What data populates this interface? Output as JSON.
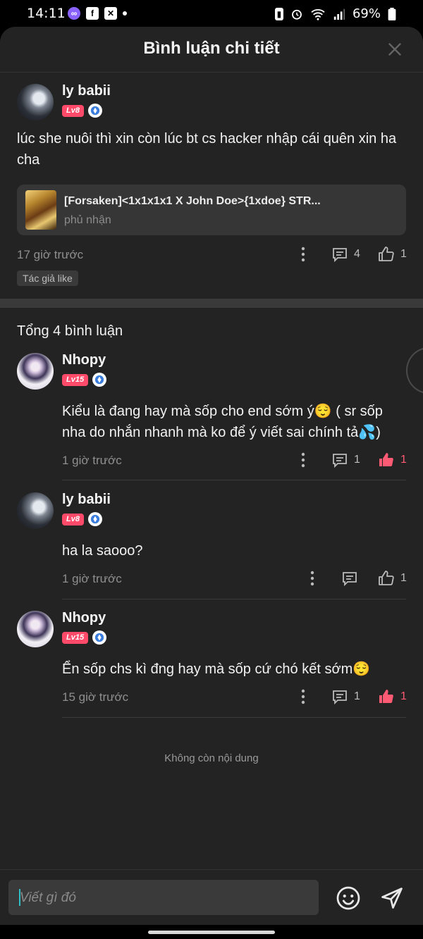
{
  "status_bar": {
    "time": "14:11",
    "battery": "69%",
    "left_icons": [
      "messenger-icon",
      "facebook-icon",
      "capcut-icon",
      "dot-icon"
    ],
    "right_icons": [
      "battery-saver-icon",
      "alarm-icon",
      "wifi-icon",
      "signal-icon",
      "battery-icon"
    ]
  },
  "header": {
    "title": "Bình luận chi tiết"
  },
  "main_comment": {
    "username": "ly babii",
    "level": "Lv8",
    "text": "lúc she nuôi thì xin còn lúc bt cs hacker nhập cái quên xin ha cha",
    "quote": {
      "title": "[Forsaken]<1x1x1x1 X John Doe>{1xdoe} STR...",
      "subtitle": "phủ nhận"
    },
    "time": "17 giờ trước",
    "reply_count": "4",
    "like_count": "1",
    "tag": "Tác giả like"
  },
  "replies_header": "Tổng 4 bình luận",
  "replies": [
    {
      "username": "Nhopy",
      "level": "Lv15",
      "text": "Kiểu là đang hay mà sốp cho end sớm ý😌 ( sr sốp nha do nhắn nhanh mà ko để ý viết sai chính tả💦)",
      "time": "1 giờ trước",
      "reply_count": "1",
      "like_count": "1",
      "liked": true
    },
    {
      "username": "ly babii",
      "level": "Lv8",
      "text": "ha la saooo?",
      "time": "1 giờ trước",
      "reply_count": "",
      "like_count": "1",
      "liked": false
    },
    {
      "username": "Nhopy",
      "level": "Lv15",
      "text": "Ển sốp chs kì đng hay mà sốp cứ chó kết sớm😌",
      "time": "15 giờ trước",
      "reply_count": "1",
      "like_count": "1",
      "liked": true
    }
  ],
  "end_text": "Không còn nội dung",
  "input": {
    "placeholder": "Viết gì đó"
  },
  "colors": {
    "background": "#232323",
    "accent_like": "#ff5a74",
    "level_badge": "#ff4a6a",
    "verified": "#3b7ddd"
  }
}
